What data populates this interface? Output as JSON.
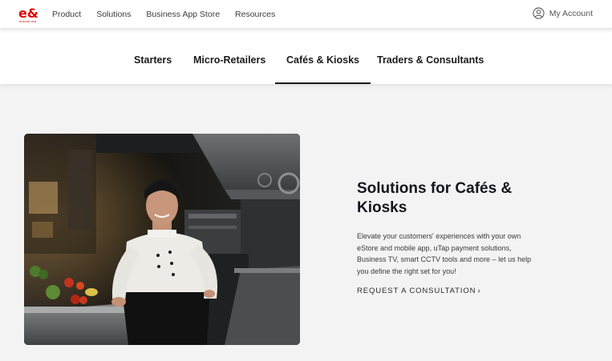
{
  "brand": {
    "logo_text": "e&",
    "logo_subtext": "etisalat and",
    "color": "#e00800"
  },
  "nav": {
    "items": [
      "Product",
      "Solutions",
      "Business App Store",
      "Resources"
    ],
    "account_label": "My Account",
    "account_icon": "user-circle-icon"
  },
  "tabs": {
    "items": [
      "Starters",
      "Micro-Retailers",
      "Cafés & Kiosks",
      "Traders & Consultants"
    ],
    "active": "Cafés & Kiosks"
  },
  "hero": {
    "title": "Solutions for Cafés & Kiosks",
    "description": "Elevate your customers' experiences with your own eStore and mobile app, uTap payment solutions, Business TV, smart CCTV tools and more – let us help you define the right set for you!",
    "cta_label": "REQUEST A CONSULTATION",
    "cta_icon": "chevron-right-icon"
  }
}
